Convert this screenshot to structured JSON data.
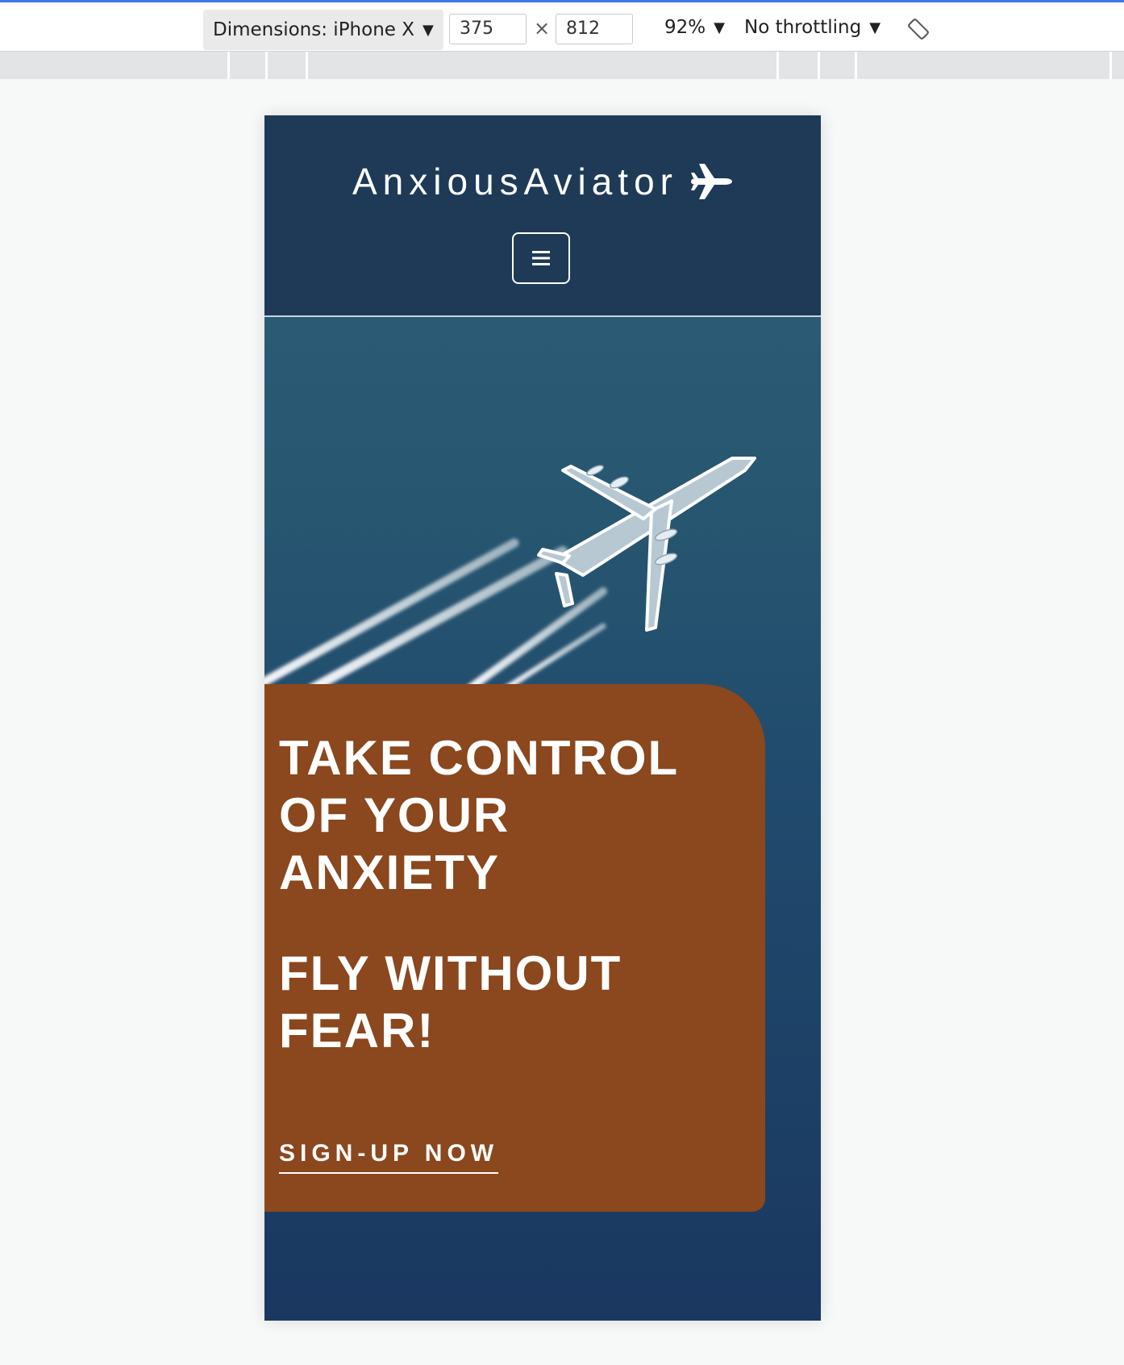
{
  "devtools": {
    "dimensions_label": "Dimensions: iPhone X",
    "width_value": "375",
    "times_symbol": "×",
    "height_value": "812",
    "zoom_label": "92%",
    "throttling_label": "No throttling",
    "caret": "▼"
  },
  "site": {
    "brand": "AnxiousAviator",
    "heading_primary": "TAKE CONTROL OF YOUR ANXIETY",
    "heading_secondary": "FLY WITHOUT FEAR!",
    "cta_label": "SIGN-UP NOW"
  },
  "colors": {
    "header_bg": "#1e3a56",
    "card_bg": "#8b471d",
    "sky": "#214b6e"
  },
  "icons": {
    "brand_icon": "airplane-icon",
    "menu_icon": "hamburger-menu-icon",
    "rotate_icon": "rotate-device-icon"
  }
}
